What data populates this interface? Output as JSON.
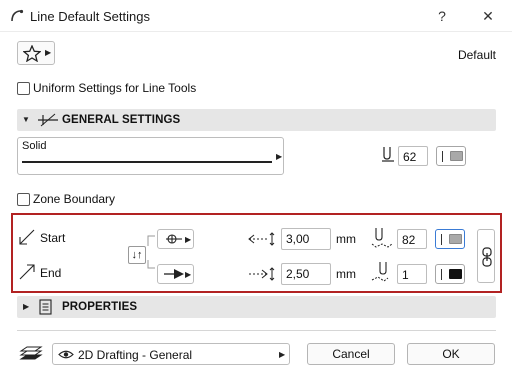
{
  "window": {
    "title": "Line Default Settings",
    "help_label": "?",
    "close_label": "✕"
  },
  "header": {
    "favorites_icon": "star-icon",
    "default_label": "Default"
  },
  "uniform_settings": {
    "label": "Uniform Settings for Line Tools",
    "checked": false
  },
  "general_settings": {
    "title": "GENERAL SETTINGS",
    "line_type": "Solid",
    "pen_number": "62",
    "pen_color": "#a9a9a9"
  },
  "zone_boundary": {
    "label": "Zone Boundary",
    "checked": false
  },
  "arrowheads": {
    "start_label": "Start",
    "end_label": "End",
    "start_length": "3,00",
    "end_length": "2,50",
    "length_unit": "mm",
    "start_pen": "82",
    "end_pen": "1",
    "start_pen_color": "#a9a9a9",
    "end_pen_color": "#111111"
  },
  "properties": {
    "title": "PROPERTIES"
  },
  "footer": {
    "layer_name": "2D Drafting - General",
    "cancel_label": "Cancel",
    "ok_label": "OK"
  }
}
